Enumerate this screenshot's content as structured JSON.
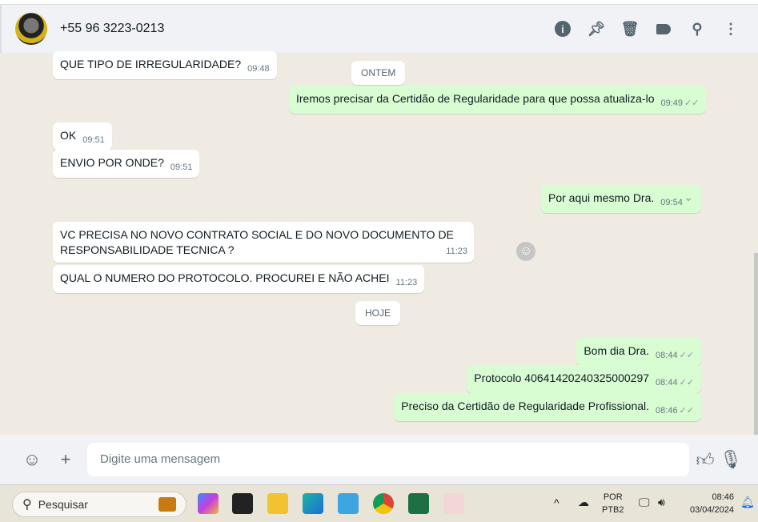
{
  "header": {
    "contact": "+55 96 3223-0213",
    "icons": [
      "info-icon",
      "pin-icon",
      "delete-icon",
      "label-icon",
      "search-icon",
      "menu-icon"
    ]
  },
  "messages": [
    {
      "dir": "in",
      "text": "QUE TIPO DE IRREGULARIDADE?",
      "time": "09:48"
    },
    {
      "day": "ONTEM"
    },
    {
      "dir": "out",
      "text": "Iremos precisar da Certidão de Regularidade para que possa atualiza-lo",
      "time": "09:49"
    },
    {
      "dir": "in",
      "text": "OK",
      "time": "09:51"
    },
    {
      "dir": "in",
      "text": "ENVIO POR ONDE?",
      "time": "09:51"
    },
    {
      "dir": "out",
      "text": "Por aqui mesmo Dra.",
      "time": "09:54"
    },
    {
      "dir": "in",
      "text": "VC PRECISA NO NOVO CONTRATO SOCIAL E DO NOVO DOCUMENTO DE",
      "text2": "RESPONSABILIDADE TECNICA ?",
      "time": "11:23"
    },
    {
      "dir": "in",
      "text": "QUAL O NUMERO DO PROTOCOLO. PROCUREI E NÃO ACHEI",
      "time": "11:23"
    },
    {
      "day": "HOJE"
    },
    {
      "dir": "out",
      "text": "Bom dia Dra.",
      "time": "08:44"
    },
    {
      "dir": "out",
      "text": "Protocolo 40641420240325000297",
      "time": "08:44"
    },
    {
      "dir": "out",
      "text": "Preciso da Certidão de Regularidade Profissional.",
      "time": "08:46"
    }
  ],
  "composer": {
    "placeholder": "Digite uma mensagem"
  },
  "taskbar": {
    "search": "Pesquisar",
    "lang1": "POR",
    "lang2": "PTB2",
    "time": "08:46",
    "date": "03/04/2024"
  },
  "colors": {
    "incoming": "#ffffff",
    "outgoing": "#d9fdd3",
    "background": "#efeae2"
  }
}
